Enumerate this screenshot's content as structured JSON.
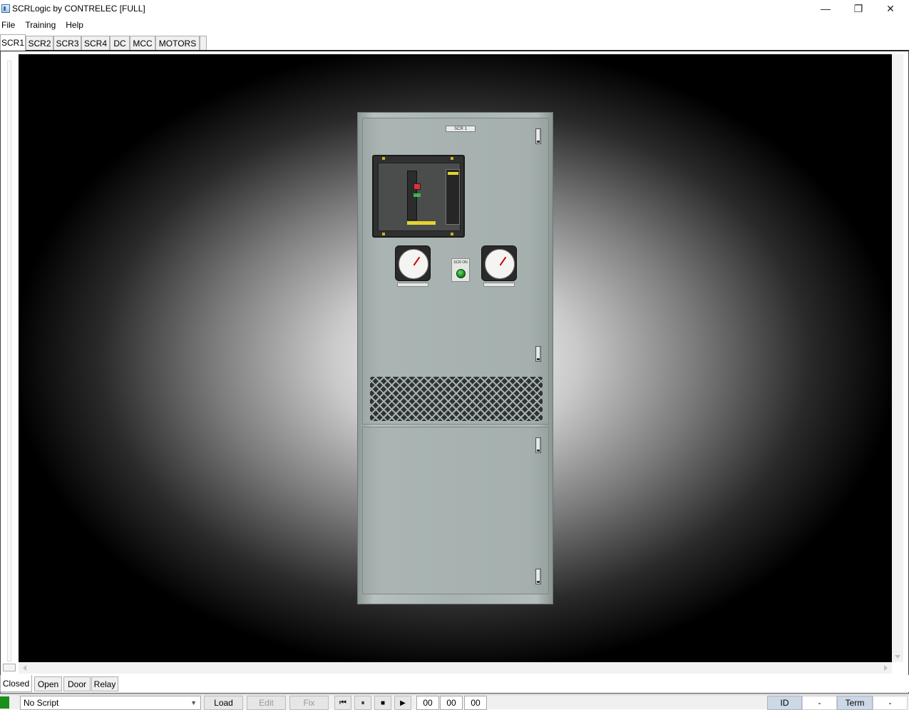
{
  "window": {
    "title": "SCRLogic by CONTRELEC [FULL]",
    "controls": {
      "minimize": "—",
      "restore": "❐",
      "close": "✕"
    }
  },
  "menu": [
    "File",
    "Training",
    "Help"
  ],
  "tabs": [
    {
      "label": "SCR1",
      "active": true
    },
    {
      "label": "SCR2",
      "active": false
    },
    {
      "label": "SCR3",
      "active": false
    },
    {
      "label": "SCR4",
      "active": false
    },
    {
      "label": "DC",
      "active": false
    },
    {
      "label": "MCC",
      "active": false
    },
    {
      "label": "MOTORS",
      "active": false
    }
  ],
  "cabinet": {
    "nameplate": "SCR 1",
    "pushbutton_label": "SCR ON",
    "colors": {
      "panel": "#a9b4b2",
      "pushbutton": "#1c8a22",
      "trip_flag": "#e0303a"
    }
  },
  "view_tabs": [
    {
      "label": "Closed",
      "active": true
    },
    {
      "label": "Open",
      "active": false
    },
    {
      "label": "Door",
      "active": false
    },
    {
      "label": "Relay",
      "active": false
    }
  ],
  "status": {
    "script_value": "No Script",
    "load_label": "Load",
    "edit_label": "Edit",
    "fix_label": "Fix",
    "transport": {
      "first": "⏮",
      "pause": "⏸",
      "stop": "■",
      "play": "▶"
    },
    "time": [
      "00",
      "00",
      "00"
    ],
    "id_label": "ID",
    "id_value": "-",
    "term_label": "Term",
    "term_value": "-",
    "led_color": "#1a8f1a"
  }
}
